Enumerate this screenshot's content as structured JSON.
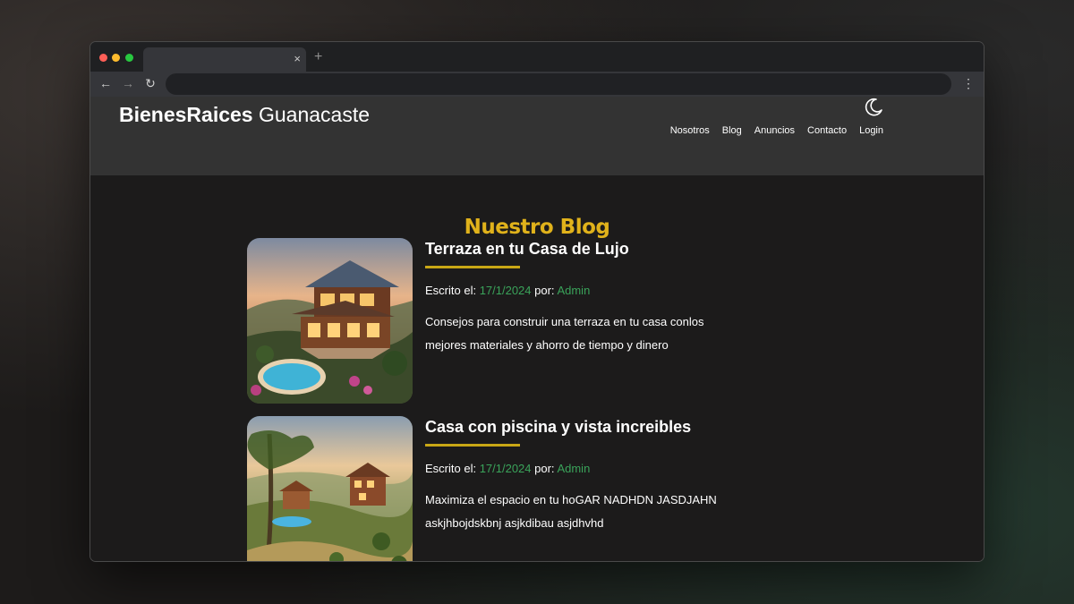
{
  "browser": {
    "tab_close": "×",
    "new_tab": "+",
    "back": "←",
    "forward": "→",
    "reload": "↻",
    "menu": "⋮"
  },
  "header": {
    "logo_bold": "BienesRaices",
    "logo_light": " Guanacaste",
    "nav": [
      "Nosotros",
      "Blog",
      "Anuncios",
      "Contacto",
      "Login"
    ]
  },
  "blog": {
    "title": "Nuestro Blog",
    "entries": [
      {
        "title": "Terraza en tu Casa de Lujo",
        "written_label": "Escrito el: ",
        "date": "17/1/2024",
        "by_label": " por: ",
        "author": "Admin",
        "excerpt": "Consejos para construir una terraza en tu casa conlos mejores materiales y ahorro de tiempo y dinero"
      },
      {
        "title": "Casa con piscina y vista increibles",
        "written_label": "Escrito el: ",
        "date": "17/1/2024",
        "by_label": " por: ",
        "author": "Admin",
        "excerpt": "Maximiza el espacio en tu hoGAR NADHDN JASDJAHN askjhbojdskbnj asjkdibau asjdhvhd"
      }
    ]
  },
  "colors": {
    "accent": "#e0b21b",
    "underline": "#c9a715",
    "meta_highlight": "#3aa35a",
    "header_bg": "#333333",
    "page_bg": "#1c1b1b"
  }
}
